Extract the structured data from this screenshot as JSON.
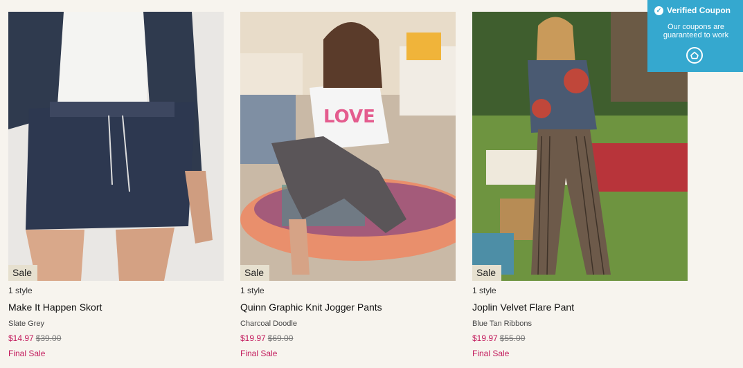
{
  "products": [
    {
      "badge": "Sale",
      "styles": "1 style",
      "name": "Make It Happen Skort",
      "color": "Slate Grey",
      "price_now": "$14.97",
      "price_was": "$39.00",
      "final": "Final Sale"
    },
    {
      "badge": "Sale",
      "styles": "1 style",
      "name": "Quinn Graphic Knit Jogger Pants",
      "color": "Charcoal Doodle",
      "price_now": "$19.97",
      "price_was": "$69.00",
      "final": "Final Sale"
    },
    {
      "badge": "Sale",
      "styles": "1 style",
      "name": "Joplin Velvet Flare Pant",
      "color": "Blue Tan Ribbons",
      "price_now": "$19.97",
      "price_was": "$55.00",
      "final": "Final Sale"
    }
  ],
  "coupon": {
    "title": "Verified Coupon",
    "subtitle": "Our coupons are guaranteed to work",
    "logo_icon": "house-logo-icon"
  },
  "colors": {
    "sale_price": "#c2185b",
    "coupon_bg": "#35a8cf",
    "page_bg": "#f7f4ee"
  }
}
